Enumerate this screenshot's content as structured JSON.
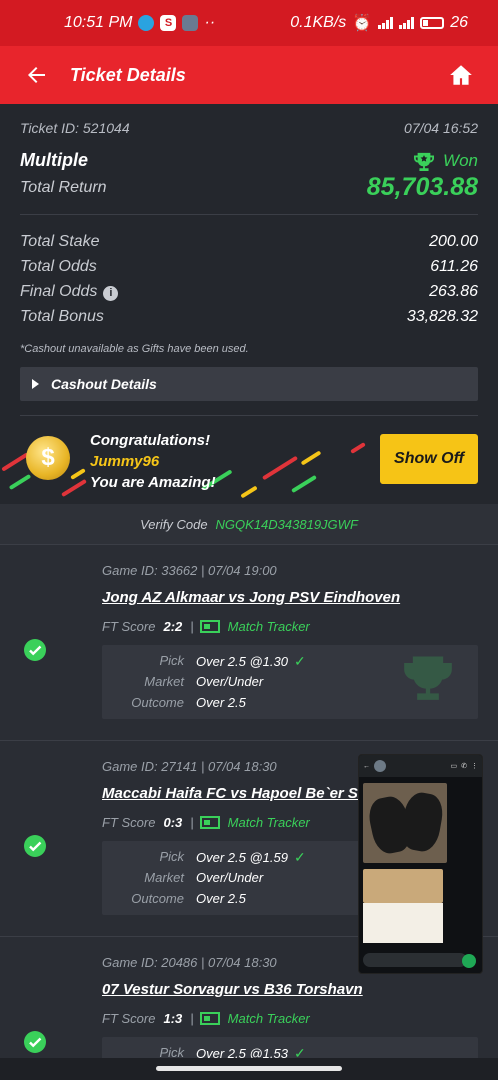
{
  "status_bar": {
    "time": "10:51 PM",
    "net_speed": "0.1KB/s",
    "network": "4G",
    "battery": "26"
  },
  "header": {
    "title": "Ticket Details",
    "back_icon": "arrow-left-icon",
    "home_icon": "home-icon"
  },
  "ticket": {
    "id_label": "Ticket ID: 521044",
    "date": "07/04 16:52",
    "type": "Multiple",
    "status": "Won",
    "total_return_label": "Total Return",
    "total_return": "85,703.88",
    "rows": [
      {
        "label": "Total Stake",
        "value": "200.00"
      },
      {
        "label": "Total Odds",
        "value": "611.26"
      },
      {
        "label": "Final Odds",
        "value": "263.86"
      },
      {
        "label": "Total Bonus",
        "value": "33,828.32"
      }
    ],
    "note": "*Cashout unavailable as Gifts have been used.",
    "cashout_label": "Cashout Details"
  },
  "congrats": {
    "line1": "Congratulations!",
    "username": "Jummy96",
    "line3": "You are Amazing!",
    "button": "Show Off"
  },
  "verify": {
    "label": "Verify Code",
    "code": "NGQK14D343819JGWF"
  },
  "games": [
    {
      "id_line": "Game ID: 33662 | 07/04 19:00",
      "match": "Jong AZ Alkmaar vs Jong PSV Eindhoven",
      "ft_label": "FT Score",
      "score": "2:2",
      "tracker": "Match Tracker",
      "pick_label": "Pick",
      "pick": "Over 2.5 @1.30",
      "market_label": "Market",
      "market": "Over/Under",
      "outcome_label": "Outcome",
      "outcome": "Over 2.5"
    },
    {
      "id_line": "Game ID: 27141 | 07/04 18:30",
      "match": "Maccabi Haifa FC vs Hapoel Be`er Sheva F",
      "ft_label": "FT Score",
      "score": "0:3",
      "tracker": "Match Tracker",
      "pick_label": "Pick",
      "pick": "Over 2.5 @1.59",
      "market_label": "Market",
      "market": "Over/Under",
      "outcome_label": "Outcome",
      "outcome": "Over 2.5"
    },
    {
      "id_line": "Game ID: 20486 | 07/04 18:30",
      "match": "07 Vestur Sorvagur vs B36 Torshavn",
      "ft_label": "FT Score",
      "score": "1:3",
      "tracker": "Match Tracker",
      "pick_label": "Pick",
      "pick": "Over 2.5 @1.53"
    }
  ],
  "colors": {
    "accent_red": "#e8252c",
    "win_green": "#3ad05a",
    "showoff_yellow": "#f6c416"
  }
}
